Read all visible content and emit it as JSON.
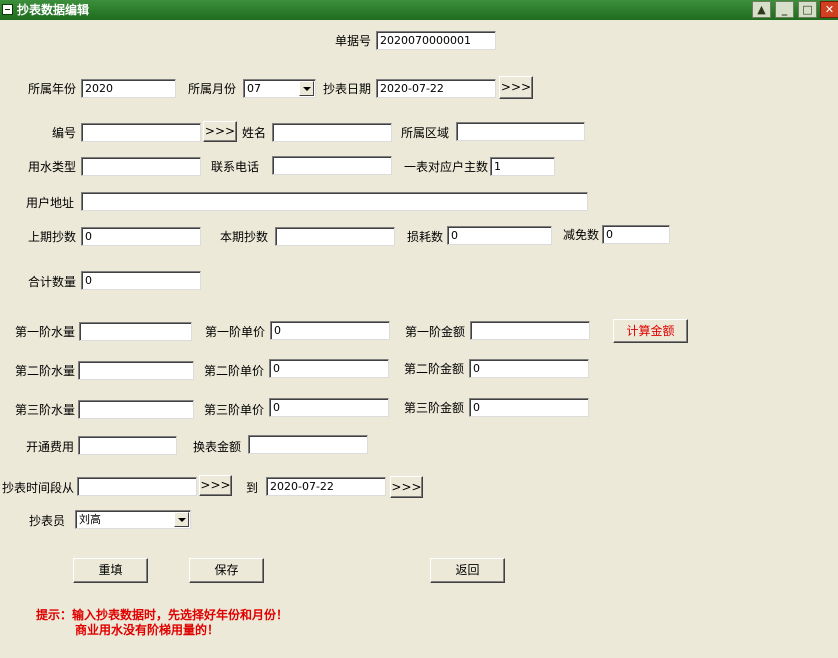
{
  "window": {
    "title": "抄表数据编辑",
    "help_glyph": "▲",
    "min_glyph": "_",
    "max_glyph": "□",
    "close_glyph": "✕"
  },
  "form": {
    "bill_no": {
      "label": "单据号",
      "value": "2020070000001"
    },
    "year": {
      "label": "所属年份",
      "value": "2020"
    },
    "month": {
      "label": "所属月份",
      "value": "07"
    },
    "reading_date": {
      "label": "抄表日期",
      "value": "2020-07-22"
    },
    "code": {
      "label": "编号",
      "value": ""
    },
    "name": {
      "label": "姓名",
      "value": ""
    },
    "region": {
      "label": "所属区域",
      "value": ""
    },
    "water_type": {
      "label": "用水类型",
      "value": ""
    },
    "phone": {
      "label": "联系电话",
      "value": ""
    },
    "households": {
      "label": "一表对应户主数",
      "value": "1"
    },
    "address": {
      "label": "用户地址",
      "value": ""
    },
    "prev_reading": {
      "label": "上期抄数",
      "value": "0"
    },
    "curr_reading": {
      "label": "本期抄数",
      "value": ""
    },
    "loss": {
      "label": "损耗数",
      "value": "0"
    },
    "reduction": {
      "label": "减免数",
      "value": "0"
    },
    "total": {
      "label": "合计数量",
      "value": "0"
    },
    "tier1": {
      "qty_label": "第一阶水量",
      "qty": "",
      "price_label": "第一阶单价",
      "price": "0",
      "amount_label": "第一阶金额",
      "amount": ""
    },
    "tier2": {
      "qty_label": "第二阶水量",
      "qty": "",
      "price_label": "第二阶单价",
      "price": "0",
      "amount_label": "第二阶金额",
      "amount": "0"
    },
    "tier3": {
      "qty_label": "第三阶水量",
      "qty": "",
      "price_label": "第三阶单价",
      "price": "0",
      "amount_label": "第三阶金额",
      "amount": "0"
    },
    "open_fee": {
      "label": "开通费用",
      "value": ""
    },
    "replace_fee": {
      "label": "换表金额",
      "value": ""
    },
    "period_from": {
      "label": "抄表时间段从",
      "value": ""
    },
    "period_to": {
      "label": "到",
      "value": "2020-07-22"
    },
    "reader": {
      "label": "抄表员",
      "value": "刘高"
    }
  },
  "buttons": {
    "picker": ">>>",
    "calc": "计算金额",
    "reset": "重填",
    "save": "保存",
    "back": "返回"
  },
  "tips": {
    "line1": "提示：输入抄表数据时，先选择好年份和月份！",
    "line2": "商业用水没有阶梯用量的！"
  }
}
